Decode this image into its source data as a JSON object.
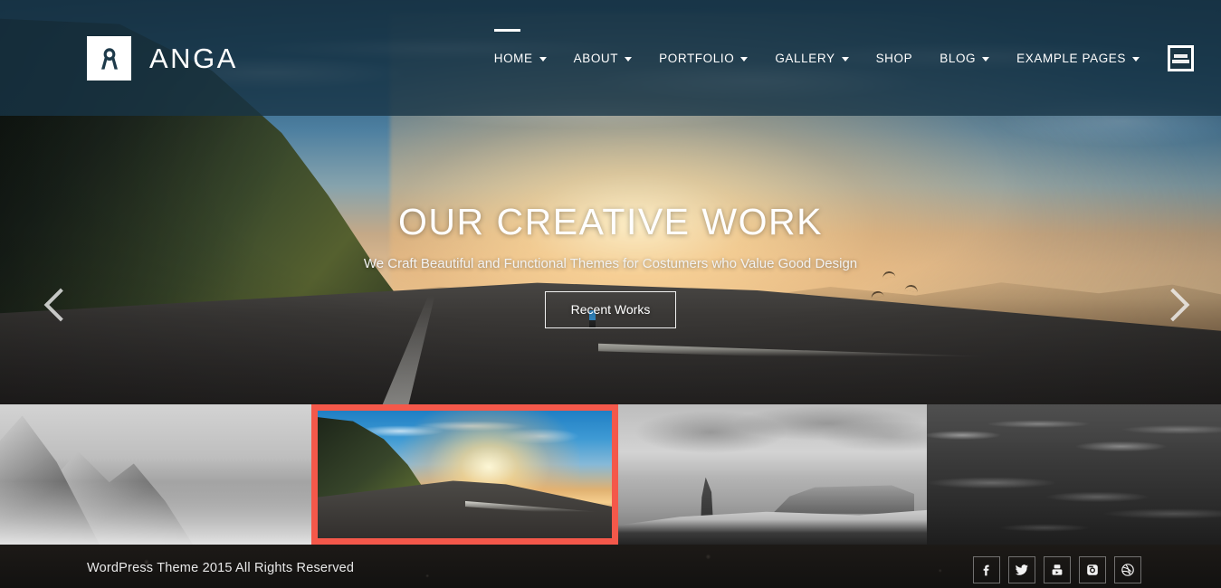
{
  "site": {
    "brand_name": "ANGA",
    "logo_icon": "letter-a-logo-icon"
  },
  "nav": {
    "items": [
      {
        "label": "HOME",
        "has_dropdown": true,
        "active": true
      },
      {
        "label": "ABOUT",
        "has_dropdown": true,
        "active": false
      },
      {
        "label": "PORTFOLIO",
        "has_dropdown": true,
        "active": false
      },
      {
        "label": "GALLERY",
        "has_dropdown": true,
        "active": false
      },
      {
        "label": "SHOP",
        "has_dropdown": false,
        "active": false
      },
      {
        "label": "BLOG",
        "has_dropdown": true,
        "active": false
      },
      {
        "label": "EXAMPLE PAGES",
        "has_dropdown": true,
        "active": false
      }
    ],
    "menu_toggle_icon": "hamburger-menu-icon"
  },
  "hero": {
    "title": "OUR CREATIVE WORK",
    "subtitle": "We Craft Beautiful and Functional Themes for Costumers who Value Good Design",
    "button_label": "Recent Works",
    "prev_icon": "chevron-left-icon",
    "next_icon": "chevron-right-icon"
  },
  "thumbnails": {
    "items": [
      {
        "name": "snowy-mountain-ridge",
        "active": false
      },
      {
        "name": "sunset-coastal-road",
        "active": true
      },
      {
        "name": "black-sand-beach",
        "active": false
      },
      {
        "name": "dark-ocean-waves",
        "active": false
      }
    ]
  },
  "footer": {
    "copyright": "WordPress Theme 2015 All Rights Reserved",
    "social": [
      {
        "name": "facebook",
        "icon": "facebook-icon"
      },
      {
        "name": "twitter",
        "icon": "twitter-icon"
      },
      {
        "name": "youtube",
        "icon": "youtube-icon"
      },
      {
        "name": "instagram",
        "icon": "instagram-icon"
      },
      {
        "name": "dribbble",
        "icon": "dribbble-icon"
      }
    ]
  },
  "colors": {
    "header_bg": "#1e3a4a",
    "accent_highlight": "#f4584a",
    "footer_bg": "#171513",
    "text_light": "#ffffff"
  }
}
